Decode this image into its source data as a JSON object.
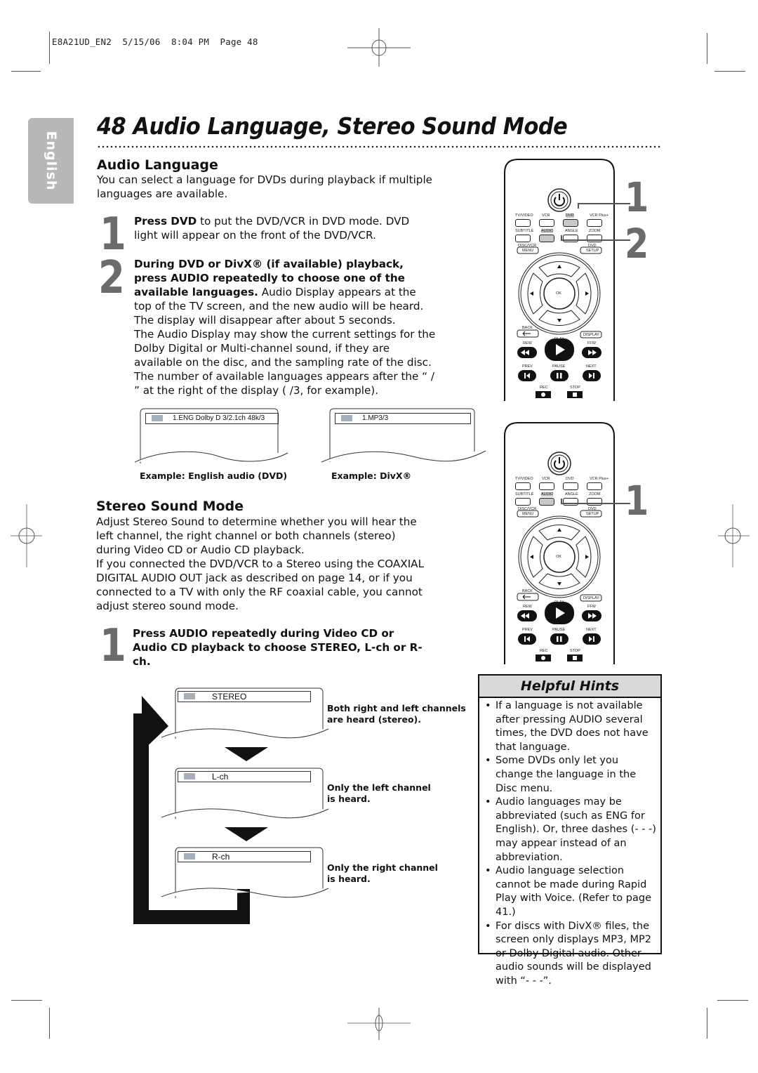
{
  "slug": "E8A21UD_EN2  5/15/06  8:04 PM  Page 48",
  "language_tab": "English",
  "title": "48  Audio Language, Stereo Sound Mode",
  "audio_language": {
    "heading": "Audio Language",
    "intro": "You can select a language for DVDs during playback if multiple languages are available.",
    "steps": [
      {
        "number": "1",
        "bold": "Press DVD",
        "text": " to put the DVD/VCR in DVD mode. DVD light will appear on the front of the DVD/VCR."
      },
      {
        "number": "2",
        "bold": "During DVD or DivX® (if available) playback, press AUDIO repeatedly to choose one of the available languages.",
        "text": " Audio Display appears at the top of the TV screen, and the new audio will be heard. The display will disappear after about 5 seconds.",
        "extra": "The Audio Display may show the current settings for the Dolby Digital or Multi-channel sound, if they are available on the disc, and the sampling rate of the disc. The number of available languages appears after the “ / ” at the right of the display ( /3, for example)."
      }
    ],
    "examples": [
      {
        "osd": "1.ENG Dolby D 3/2.1ch 48k/3",
        "caption": "Example: English audio (DVD)"
      },
      {
        "osd": "1.MP3/3",
        "caption": "Example: DivX®"
      }
    ]
  },
  "stereo_sound": {
    "heading": "Stereo Sound Mode",
    "intro": "Adjust Stereo Sound to determine whether you will hear the left channel, the right channel or both channels (stereo) during Video CD or Audio CD playback.",
    "note": "If you connected the DVD/VCR to a Stereo using the COAXIAL DIGITAL AUDIO OUT jack as described on page 14, or if you connected to a TV with only the RF coaxial cable, you cannot adjust stereo sound mode.",
    "step": {
      "number": "1",
      "bold": "Press AUDIO repeatedly during Video CD or Audio CD playback to choose STEREO, L-ch or R-ch."
    },
    "modes": [
      {
        "osd": "STEREO",
        "caption": "Both right and left channels are heard (stereo)."
      },
      {
        "osd": "L-ch",
        "caption": "Only the left channel is heard."
      },
      {
        "osd": "R-ch",
        "caption": "Only the right channel is heard."
      }
    ]
  },
  "remote": {
    "row1": [
      "TV/VIDEO",
      "VCR",
      "DVD",
      "VCR Plus+"
    ],
    "row2": [
      "SUBTITLE",
      "AUDIO",
      "ANGLE",
      "ZOOM"
    ],
    "disc_vcr": "DISC/VCR",
    "menu": "MENU",
    "dvd": "DVD",
    "setup": "SETUP",
    "ok": "OK",
    "back": "BACK",
    "display": "DISPLAY",
    "play": "PLAY",
    "rew": "REW",
    "ffw": "FFW",
    "prev": "PREV",
    "pause": "PAUSE",
    "next": "NEXT",
    "rec": "REC",
    "stop": "STOP",
    "callouts_top": [
      "1",
      "2"
    ],
    "callouts_bottom": [
      "1"
    ]
  },
  "hints": {
    "title": "Helpful Hints",
    "items": [
      "If a language is not available after pressing AUDIO several times, the DVD does not have that language.",
      "Some DVDs only let you change the language in the Disc menu.",
      "Audio languages may be abbreviated (such as ENG for English). Or, three dashes (- - -) may appear instead of an abbreviation.",
      "Audio language selection cannot be made during Rapid Play with Voice. (Refer to page 41.)",
      "For discs with DivX® files, the screen only displays MP3, MP2 or Dolby Digital audio. Other audio sounds will be displayed with “- - -”."
    ]
  }
}
